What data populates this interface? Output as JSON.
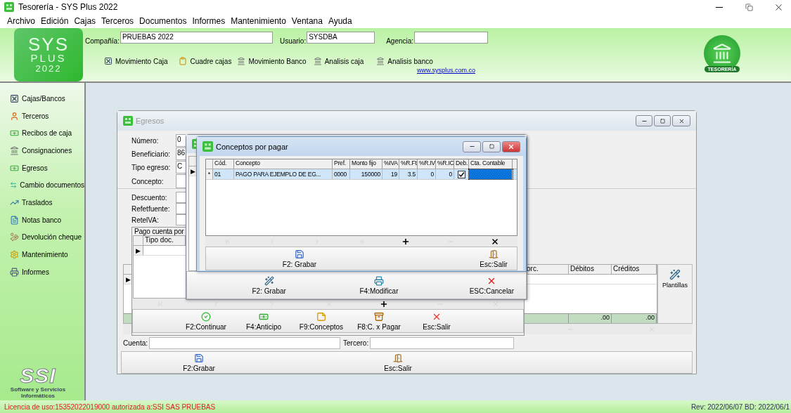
{
  "window": {
    "title": "Tesorería - SYS Plus 2022"
  },
  "menu": [
    "Archivo",
    "Edición",
    "Cajas",
    "Terceros",
    "Documentos",
    "Informes",
    "Mantenimiento",
    "Ventana",
    "Ayuda"
  ],
  "header": {
    "logo": {
      "line1": "SYS",
      "line2": "PLUS",
      "line3": "2022"
    },
    "fields": [
      {
        "label": "Compañía:",
        "value": "PRUEBAS 2022"
      },
      {
        "label": "Usuario:",
        "value": "SYSDBA"
      },
      {
        "label": "Agencia:"
      }
    ],
    "toolbar": [
      "Movimiento Caja",
      "Cuadre cajas",
      "Movimiento Banco",
      "Analisis caja",
      "Analisis banco"
    ],
    "link": "www.sysplus.com.co",
    "badge": "TESORERÍA"
  },
  "sidebar": {
    "items": [
      "Cajas/Bancos",
      "Terceros",
      "Recibos de caja",
      "Consignaciones",
      "Egresos",
      "Cambio documentos",
      "Traslados",
      "Notas banco",
      "Devolución cheque",
      "Mantenimiento",
      "Informes"
    ],
    "logo": {
      "mark": "SSI",
      "caption": "Software y Servicios Informáticos"
    }
  },
  "egresos": {
    "title": "Egresos",
    "fields_top": [
      {
        "label": "Número:",
        "value": "0"
      },
      {
        "label": "Beneficiario:",
        "value": "86"
      },
      {
        "label": "Tipo egreso:",
        "value": "C"
      },
      {
        "label": "Concepto:"
      }
    ],
    "fields_bottom": [
      {
        "label": "Descuento:"
      },
      {
        "label": "Refetfuente:"
      },
      {
        "label": "RetelVA:"
      }
    ],
    "pago": {
      "title": "Pago cuenta por",
      "columns": [
        "Tipo doc."
      ],
      "marker": "▶",
      "nav": [
        {
          "kind": "first",
          "disabled": true
        },
        {
          "kind": "prev",
          "disabled": true
        },
        {
          "kind": "next",
          "disabled": true
        },
        {
          "kind": "last",
          "disabled": true
        },
        {
          "kind": "add",
          "disabled": false
        },
        {
          "kind": "remove",
          "disabled": true
        },
        {
          "kind": "delete",
          "disabled": true
        }
      ],
      "buttons": [
        "F2:Continuar",
        "F4:Anticipo",
        "F9:Conceptos",
        "F8:C. x Pagar",
        "Esc:Salir"
      ]
    },
    "movimientos": {
      "columns": [
        "orc.",
        "Débitos",
        "Créditos"
      ],
      "marker": "▶",
      "totals": [
        ".00",
        ".00"
      ],
      "template_button": "Plantillas",
      "nav": [
        {
          "kind": "remove",
          "disabled": true
        },
        {
          "kind": "delete",
          "disabled": true
        }
      ]
    },
    "cuenta_label": "Cuenta:",
    "tercero_label": "Tercero:",
    "buttons": [
      "F2:Grabar",
      "Esc:Salir"
    ]
  },
  "detalle": {
    "marker": "▶",
    "buttons": [
      "F2: Grabar",
      "F4:Modificar",
      "ESC:Cancelar"
    ]
  },
  "conceptos": {
    "title": "Conceptos por pagar",
    "columns": [
      {
        "label": "Cód.",
        "kind": "text"
      },
      {
        "label": "Concepto",
        "kind": "text"
      },
      {
        "label": "Pref.",
        "kind": "text"
      },
      {
        "label": "Monto fijo",
        "kind": "number"
      },
      {
        "label": "%IVA",
        "kind": "number"
      },
      {
        "label": "%R.Ft",
        "kind": "number"
      },
      {
        "label": "%R.IV",
        "kind": "number"
      },
      {
        "label": "%R.IC",
        "kind": "number"
      },
      {
        "label": "Deb.",
        "kind": "check"
      },
      {
        "label": "Cta. Contable",
        "kind": "text"
      }
    ],
    "rows": [
      {
        "marker": "*",
        "selected": true,
        "cells": [
          {
            "text": "01"
          },
          {
            "text": "PAGO PARA EJEMPLO DE EG..."
          },
          {
            "text": "0000"
          },
          {
            "text": "150000"
          },
          {
            "text": "19"
          },
          {
            "text": "3.5"
          },
          {
            "text": "0"
          },
          {
            "text": "0"
          },
          {
            "checked": true
          },
          {
            "focused": true
          }
        ]
      }
    ],
    "nav": [
      {
        "kind": "first",
        "disabled": true
      },
      {
        "kind": "prev",
        "disabled": true
      },
      {
        "kind": "next",
        "disabled": true
      },
      {
        "kind": "last",
        "disabled": true
      },
      {
        "kind": "add",
        "disabled": false
      },
      {
        "kind": "remove",
        "disabled": true
      },
      {
        "kind": "delete",
        "disabled": false
      }
    ],
    "buttons": [
      "F2: Grabar",
      "Esc:Salir"
    ]
  },
  "status_bar": {
    "license": "Licencia de uso:15352022019000 autorizada a:SSI SAS PRUEBAS",
    "revision": "Rev: 2022/06/07 BD: 2022/06/1"
  }
}
